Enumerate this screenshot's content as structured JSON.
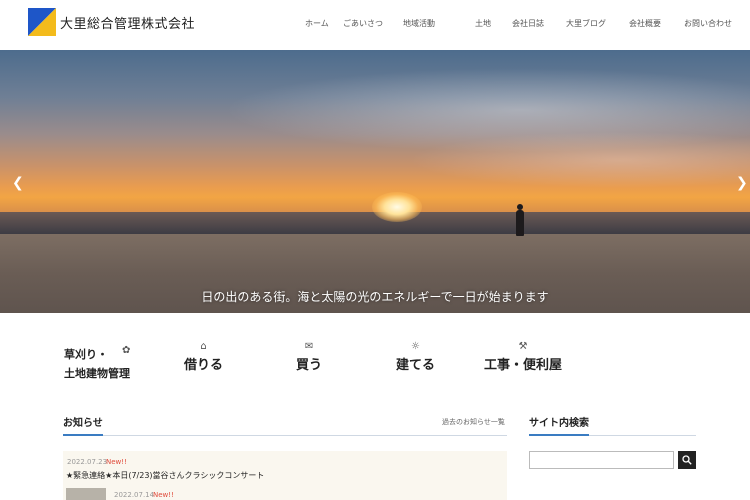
{
  "header": {
    "site_name": "大里総合管理株式会社",
    "nav": [
      "ホーム",
      "ごあいさつ",
      "地域活動",
      "土地",
      "会社日誌",
      "大里ブログ",
      "会社概要",
      "お問い合わせ"
    ]
  },
  "hero": {
    "caption": "日の出のある街。海と太陽の光のエネルギーで一日が始まります",
    "prev_icon": "chevron-left-icon",
    "next_icon": "chevron-right-icon"
  },
  "services": [
    {
      "label": "草刈り・\n土地建物管理",
      "line1": "草刈り・",
      "line2": "土地建物管理",
      "icon": "grass-icon"
    },
    {
      "label": "借りる",
      "icon": "house-icon"
    },
    {
      "label": "買う",
      "icon": "handshake-icon"
    },
    {
      "label": "建てる",
      "icon": "sun-icon"
    },
    {
      "label": "工事・便利屋",
      "icon": "tools-icon"
    }
  ],
  "news": {
    "title": "お知らせ",
    "more_link": "過去のお知らせ一覧",
    "items": [
      {
        "date": "2022.07.23",
        "badge": "New!!",
        "title": "★緊急連絡★本日(7/23)當谷さんクラシックコンサート"
      },
      {
        "date": "2022.07.14",
        "badge": "New!!",
        "title": ""
      }
    ]
  },
  "sidebar": {
    "search_title": "サイト内検索",
    "search_placeholder": "",
    "search_icon": "search-icon"
  },
  "colors": {
    "brand_blue": "#1e56c8",
    "brand_yellow": "#f3bb1c",
    "accent_blue": "#3a7cc2",
    "new_badge": "#e04b3b",
    "highlight": "#f6d86b"
  }
}
